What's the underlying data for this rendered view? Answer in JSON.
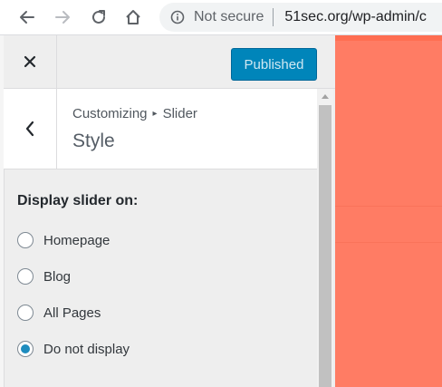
{
  "browser": {
    "security_label": "Not secure",
    "url": "51sec.org/wp-admin/c"
  },
  "customizer": {
    "publish_label": "Published",
    "breadcrumb_root": "Customizing",
    "breadcrumb_section": "Slider",
    "section_title": "Style",
    "control_heading": "Display slider on:",
    "options": [
      {
        "label": "Homepage",
        "checked": false
      },
      {
        "label": "Blog",
        "checked": false
      },
      {
        "label": "All Pages",
        "checked": false
      },
      {
        "label": "Do not display",
        "checked": true
      }
    ]
  },
  "colors": {
    "preview_bg": "#ff7c64",
    "publish_button": "#0085ba",
    "radio_selected": "#1e8cbe"
  },
  "icons": [
    "back-arrow-icon",
    "forward-arrow-icon",
    "reload-icon",
    "home-icon",
    "info-icon",
    "close-icon",
    "chevron-left-icon",
    "scroll-up-icon"
  ]
}
